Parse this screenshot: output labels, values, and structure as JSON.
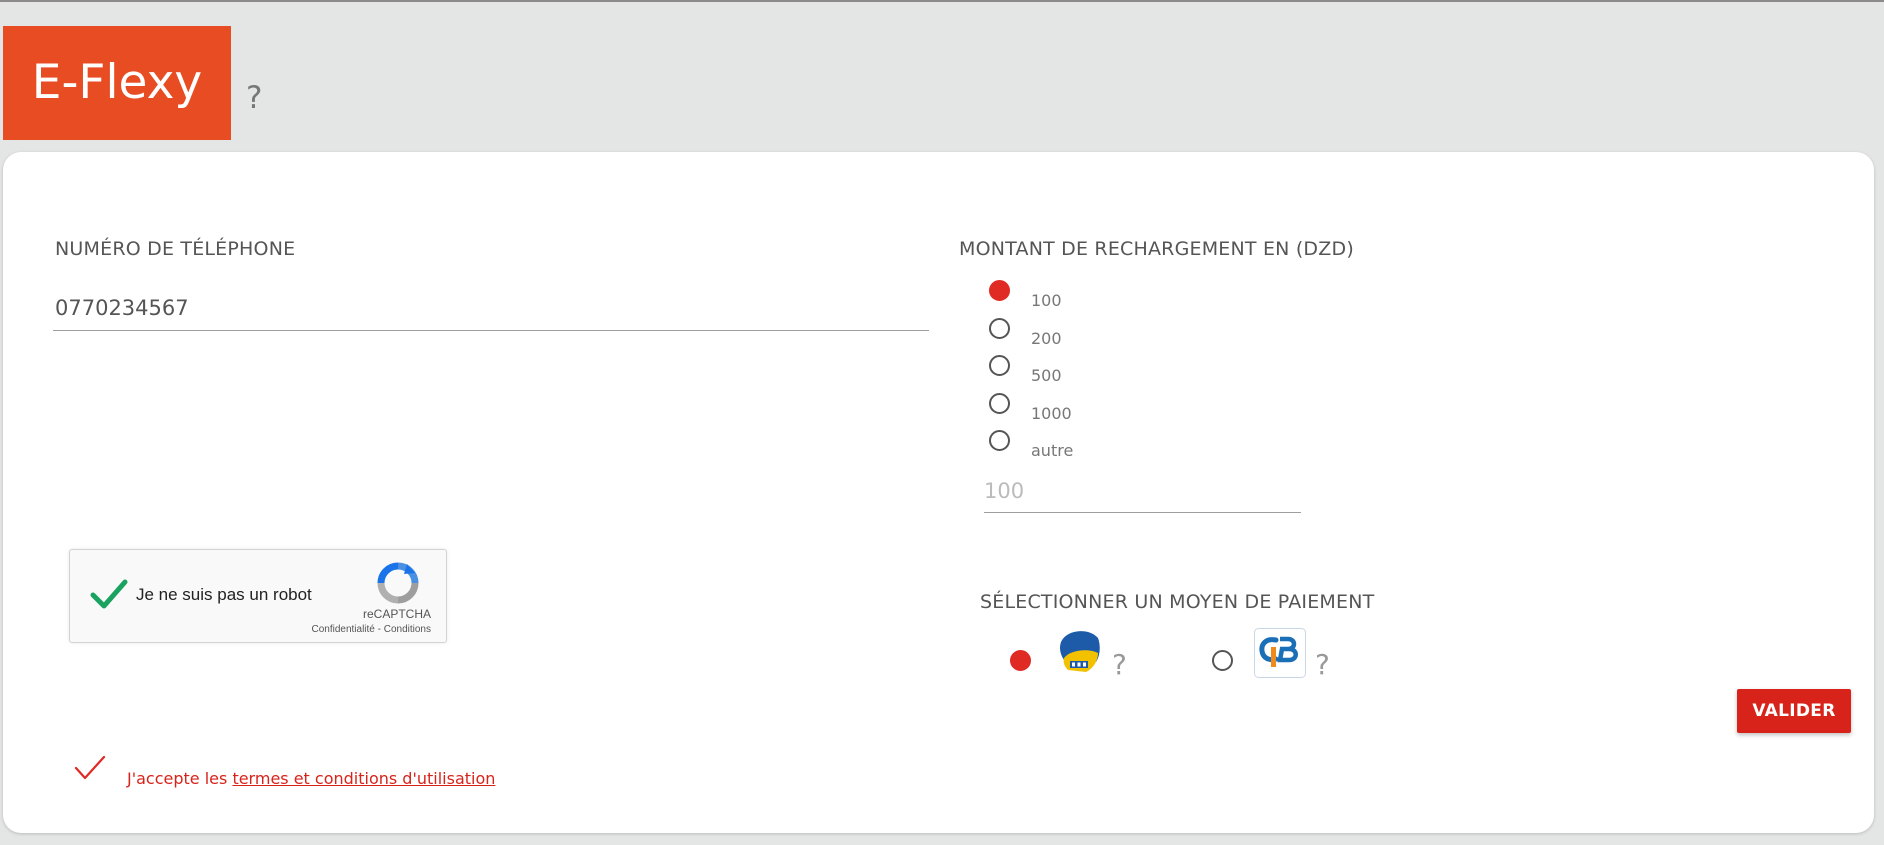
{
  "header": {
    "brand": "E-Flexy",
    "help_mark": "?"
  },
  "form": {
    "phone": {
      "label": "NUMÉRO DE TÉLÉPHONE",
      "value": "0770234567"
    },
    "amount": {
      "label": "MONTANT DE RECHARGEMENT EN (DZD)",
      "options": [
        "100",
        "200",
        "500",
        "1000",
        "autre"
      ],
      "selected": "100",
      "other_placeholder": "100"
    },
    "captcha": {
      "text": "Je ne suis pas un robot",
      "brand": "reCAPTCHA",
      "links": "Confidentialité - Conditions",
      "checked": true
    },
    "payment": {
      "label": "SÉLECTIONNER UN MOYEN DE PAIEMENT",
      "options": [
        {
          "icon": "edahabia-card-icon",
          "help": "?",
          "selected": true
        },
        {
          "icon": "cib-card-icon",
          "help": "?",
          "selected": false
        }
      ]
    },
    "submit_label": "VALIDER",
    "terms": {
      "prefix": "J'accepte les ",
      "link_text": "termes et conditions d'utilisation",
      "checked": true
    }
  },
  "colors": {
    "brand": "#e84c22",
    "accent": "#e02a24",
    "button": "#d8231b",
    "background": "#e4e5e5"
  }
}
